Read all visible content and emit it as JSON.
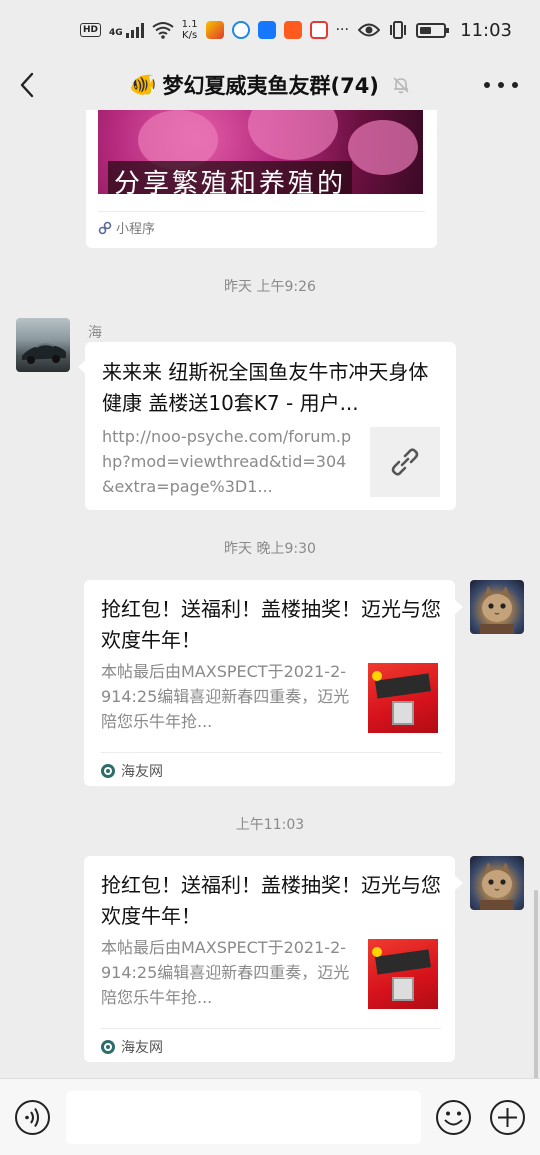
{
  "status_bar": {
    "hd": "HD",
    "network": "4G",
    "speed_value": "1.1",
    "speed_unit": "K/s",
    "more": "···",
    "time": "11:03"
  },
  "nav": {
    "title": "梦幻夏威夷鱼友群(74)",
    "fish_emoji": "🐠"
  },
  "chat": {
    "mini_program": {
      "image_caption": "分享繁殖和养殖的",
      "footer_label": "小程序"
    },
    "timestamps": [
      "昨天 上午9:26",
      "昨天 晚上9:30",
      "上午11:03"
    ],
    "link_message": {
      "sender": "海",
      "title": "来来来 纽斯祝全国鱼友牛市冲天身体健康 盖楼送10套K7 - 用户...",
      "url": "http://noo-psyche.com/forum.php?mod=viewthread&tid=304&extra=page%3D1..."
    },
    "posts": [
      {
        "title": "抢红包！送福利！盖楼抽奖！迈光与您欢度牛年！",
        "desc": "本帖最后由MAXSPECT于2021-2-914:25编辑喜迎新春四重奏，迈光陪您乐牛年抢...",
        "source": "海友网"
      },
      {
        "title": "抢红包！送福利！盖楼抽奖！迈光与您欢度牛年！",
        "desc": "本帖最后由MAXSPECT于2021-2-914:25编辑喜迎新春四重奏，迈光陪您乐牛年抢...",
        "source": "海友网"
      }
    ]
  },
  "input_bar": {
    "placeholder": ""
  },
  "colors": {
    "background": "#ededed",
    "bubble": "#ffffff",
    "muted_text": "#8a8a8a"
  }
}
